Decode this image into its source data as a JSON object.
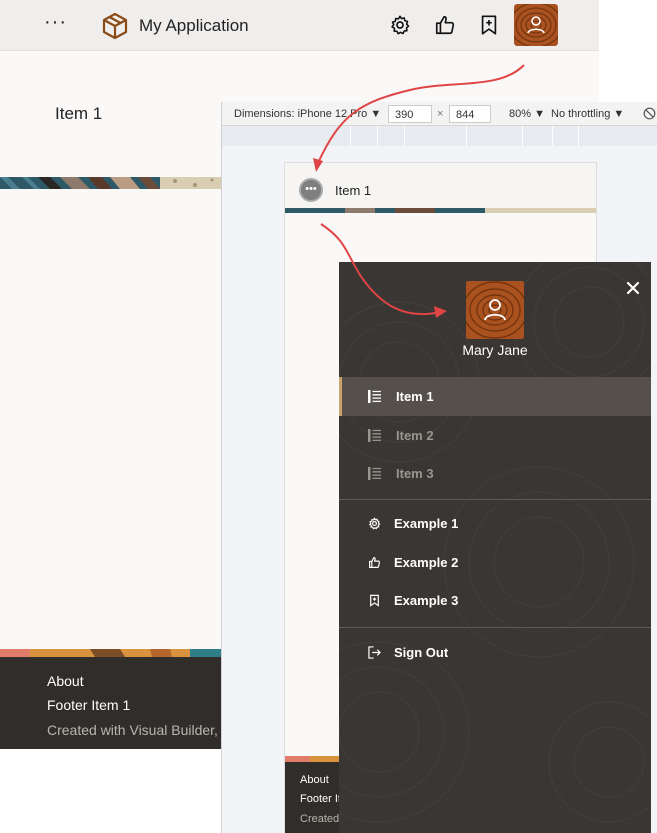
{
  "app": {
    "title": "My Application",
    "page_title": "Item 1",
    "footer": [
      "About",
      "Footer Item 1",
      "Created with Visual Builder, O"
    ]
  },
  "devtools": {
    "device": "Dimensions: iPhone 12 Pro ▼",
    "width": "390",
    "height": "844",
    "times": "×",
    "zoom": "80% ▼",
    "throttle": "No throttling ▼"
  },
  "phone": {
    "title": "Item 1",
    "footer": [
      "About",
      "Footer It",
      "Created"
    ]
  },
  "drawer": {
    "user_name": "Mary Jane",
    "nav_items": [
      "Item 1",
      "Item 2",
      "Item 3"
    ],
    "example_items": [
      "Example 1",
      "Example 2",
      "Example 3"
    ],
    "sign_out": "Sign Out"
  },
  "colors": {
    "accent": "#c9a46a",
    "drawer_bg": "#3a3633",
    "footer_bg": "#312d2a",
    "arrow": "#e04545"
  }
}
